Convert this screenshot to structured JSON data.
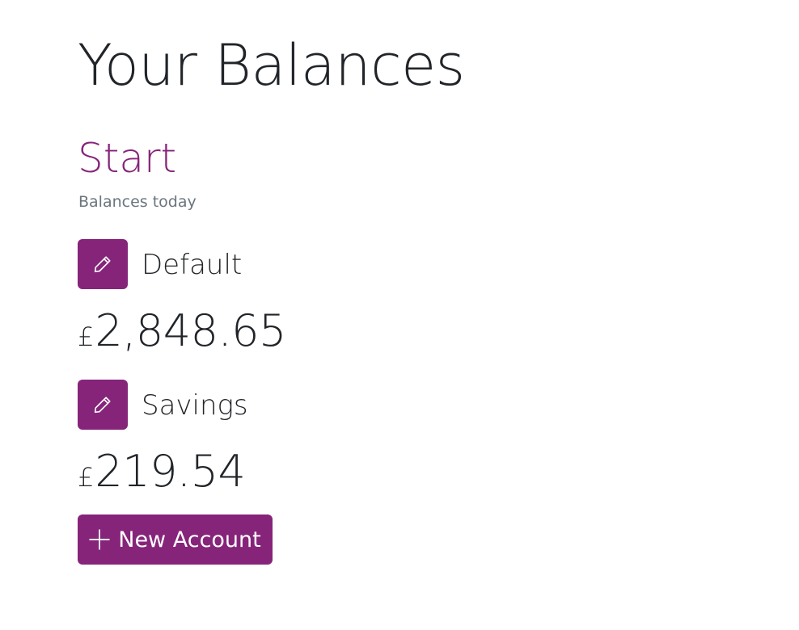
{
  "page": {
    "title": "Your Balances"
  },
  "section": {
    "title": "Start",
    "subtitle": "Balances today"
  },
  "accounts": [
    {
      "name": "Default",
      "currency_symbol": "£",
      "balance": "2,848.65",
      "edit_icon": "pencil-icon"
    },
    {
      "name": "Savings",
      "currency_symbol": "£",
      "balance": "219.54",
      "edit_icon": "pencil-icon"
    }
  ],
  "actions": {
    "new_account_label": "New Account",
    "new_account_icon": "plus-icon"
  },
  "colors": {
    "accent": "#86247a",
    "text": "#212529",
    "muted": "#6c757d"
  }
}
